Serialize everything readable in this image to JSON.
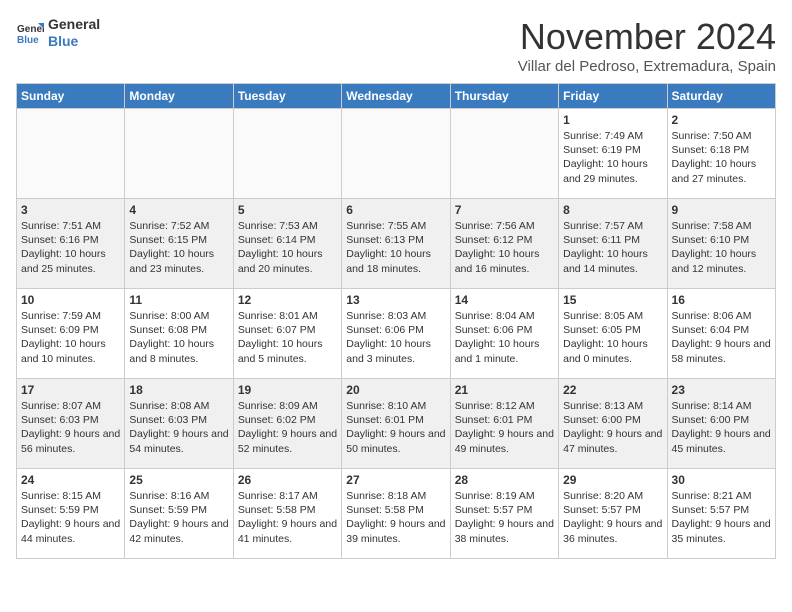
{
  "logo": {
    "line1": "General",
    "line2": "Blue"
  },
  "title": "November 2024",
  "location": "Villar del Pedroso, Extremadura, Spain",
  "days_of_week": [
    "Sunday",
    "Monday",
    "Tuesday",
    "Wednesday",
    "Thursday",
    "Friday",
    "Saturday"
  ],
  "weeks": [
    [
      {
        "day": "",
        "data": ""
      },
      {
        "day": "",
        "data": ""
      },
      {
        "day": "",
        "data": ""
      },
      {
        "day": "",
        "data": ""
      },
      {
        "day": "",
        "data": ""
      },
      {
        "day": "1",
        "data": "Sunrise: 7:49 AM\nSunset: 6:19 PM\nDaylight: 10 hours and 29 minutes."
      },
      {
        "day": "2",
        "data": "Sunrise: 7:50 AM\nSunset: 6:18 PM\nDaylight: 10 hours and 27 minutes."
      }
    ],
    [
      {
        "day": "3",
        "data": "Sunrise: 7:51 AM\nSunset: 6:16 PM\nDaylight: 10 hours and 25 minutes."
      },
      {
        "day": "4",
        "data": "Sunrise: 7:52 AM\nSunset: 6:15 PM\nDaylight: 10 hours and 23 minutes."
      },
      {
        "day": "5",
        "data": "Sunrise: 7:53 AM\nSunset: 6:14 PM\nDaylight: 10 hours and 20 minutes."
      },
      {
        "day": "6",
        "data": "Sunrise: 7:55 AM\nSunset: 6:13 PM\nDaylight: 10 hours and 18 minutes."
      },
      {
        "day": "7",
        "data": "Sunrise: 7:56 AM\nSunset: 6:12 PM\nDaylight: 10 hours and 16 minutes."
      },
      {
        "day": "8",
        "data": "Sunrise: 7:57 AM\nSunset: 6:11 PM\nDaylight: 10 hours and 14 minutes."
      },
      {
        "day": "9",
        "data": "Sunrise: 7:58 AM\nSunset: 6:10 PM\nDaylight: 10 hours and 12 minutes."
      }
    ],
    [
      {
        "day": "10",
        "data": "Sunrise: 7:59 AM\nSunset: 6:09 PM\nDaylight: 10 hours and 10 minutes."
      },
      {
        "day": "11",
        "data": "Sunrise: 8:00 AM\nSunset: 6:08 PM\nDaylight: 10 hours and 8 minutes."
      },
      {
        "day": "12",
        "data": "Sunrise: 8:01 AM\nSunset: 6:07 PM\nDaylight: 10 hours and 5 minutes."
      },
      {
        "day": "13",
        "data": "Sunrise: 8:03 AM\nSunset: 6:06 PM\nDaylight: 10 hours and 3 minutes."
      },
      {
        "day": "14",
        "data": "Sunrise: 8:04 AM\nSunset: 6:06 PM\nDaylight: 10 hours and 1 minute."
      },
      {
        "day": "15",
        "data": "Sunrise: 8:05 AM\nSunset: 6:05 PM\nDaylight: 10 hours and 0 minutes."
      },
      {
        "day": "16",
        "data": "Sunrise: 8:06 AM\nSunset: 6:04 PM\nDaylight: 9 hours and 58 minutes."
      }
    ],
    [
      {
        "day": "17",
        "data": "Sunrise: 8:07 AM\nSunset: 6:03 PM\nDaylight: 9 hours and 56 minutes."
      },
      {
        "day": "18",
        "data": "Sunrise: 8:08 AM\nSunset: 6:03 PM\nDaylight: 9 hours and 54 minutes."
      },
      {
        "day": "19",
        "data": "Sunrise: 8:09 AM\nSunset: 6:02 PM\nDaylight: 9 hours and 52 minutes."
      },
      {
        "day": "20",
        "data": "Sunrise: 8:10 AM\nSunset: 6:01 PM\nDaylight: 9 hours and 50 minutes."
      },
      {
        "day": "21",
        "data": "Sunrise: 8:12 AM\nSunset: 6:01 PM\nDaylight: 9 hours and 49 minutes."
      },
      {
        "day": "22",
        "data": "Sunrise: 8:13 AM\nSunset: 6:00 PM\nDaylight: 9 hours and 47 minutes."
      },
      {
        "day": "23",
        "data": "Sunrise: 8:14 AM\nSunset: 6:00 PM\nDaylight: 9 hours and 45 minutes."
      }
    ],
    [
      {
        "day": "24",
        "data": "Sunrise: 8:15 AM\nSunset: 5:59 PM\nDaylight: 9 hours and 44 minutes."
      },
      {
        "day": "25",
        "data": "Sunrise: 8:16 AM\nSunset: 5:59 PM\nDaylight: 9 hours and 42 minutes."
      },
      {
        "day": "26",
        "data": "Sunrise: 8:17 AM\nSunset: 5:58 PM\nDaylight: 9 hours and 41 minutes."
      },
      {
        "day": "27",
        "data": "Sunrise: 8:18 AM\nSunset: 5:58 PM\nDaylight: 9 hours and 39 minutes."
      },
      {
        "day": "28",
        "data": "Sunrise: 8:19 AM\nSunset: 5:57 PM\nDaylight: 9 hours and 38 minutes."
      },
      {
        "day": "29",
        "data": "Sunrise: 8:20 AM\nSunset: 5:57 PM\nDaylight: 9 hours and 36 minutes."
      },
      {
        "day": "30",
        "data": "Sunrise: 8:21 AM\nSunset: 5:57 PM\nDaylight: 9 hours and 35 minutes."
      }
    ]
  ]
}
